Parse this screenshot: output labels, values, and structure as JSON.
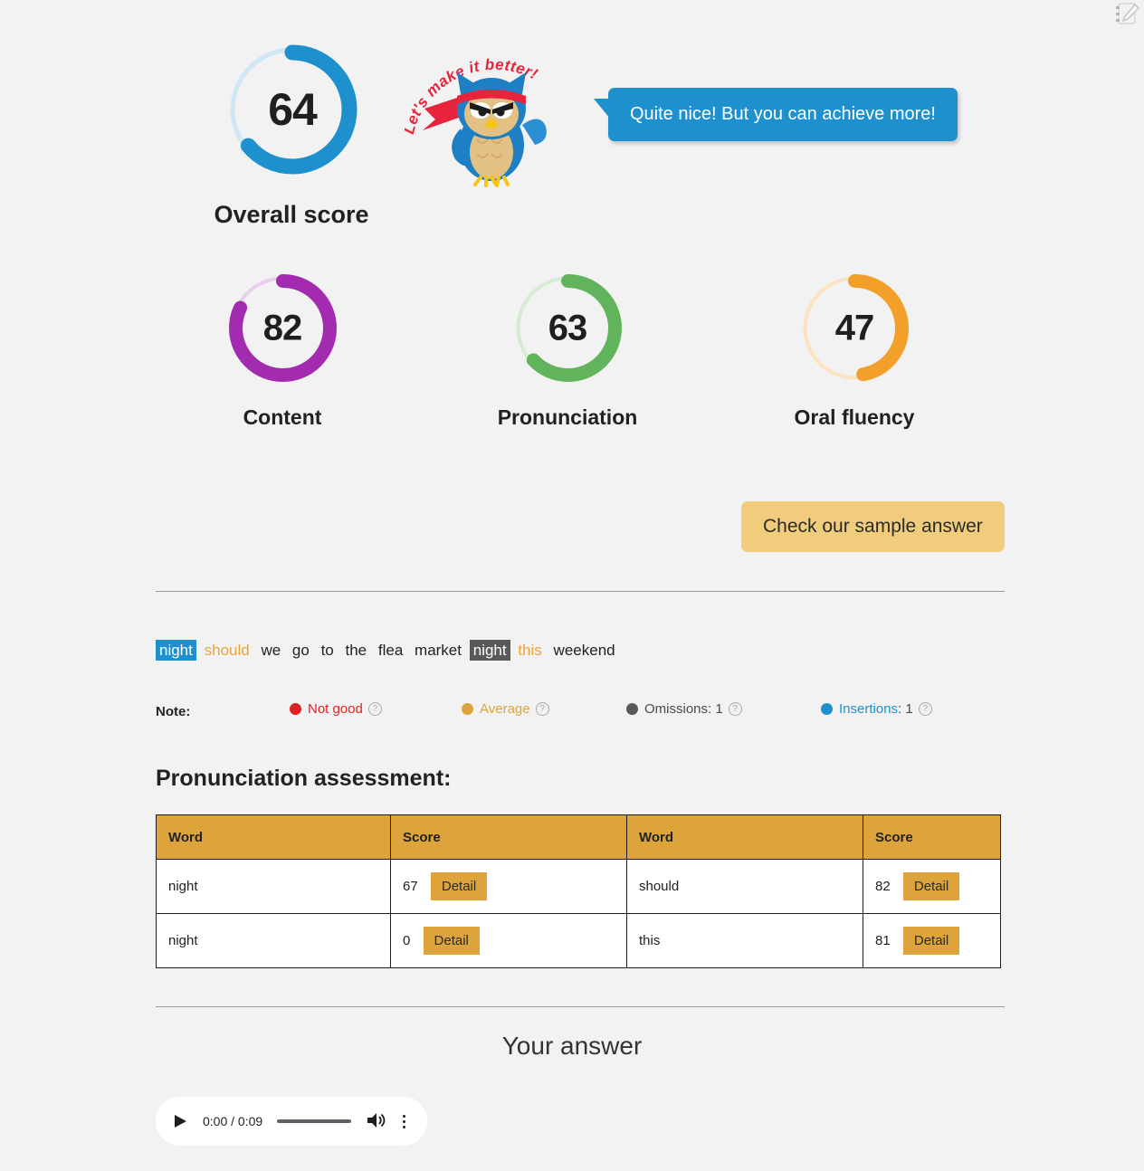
{
  "corner": {
    "icon": "notes-edit-icon"
  },
  "overall": {
    "value": "64",
    "label": "Overall score",
    "color": "#1f90ce",
    "track_color": "#cfe6f4"
  },
  "mascot": {
    "icon": "ninja-owl-mascot",
    "banner_text": "Let's make it better!"
  },
  "bubble": {
    "text": "Quite nice! But you can achieve more!",
    "color": "#1f90ce"
  },
  "sub_scores": [
    {
      "value": "82",
      "label": "Content",
      "color": "#a32baf",
      "track_color": "#e8d0ec"
    },
    {
      "value": "63",
      "label": "Pronunciation",
      "color": "#62b45c",
      "track_color": "#d6ead4"
    },
    {
      "value": "47",
      "label": "Oral fluency",
      "color": "#f2a02a",
      "track_color": "#fbe3bf"
    }
  ],
  "sample_button": {
    "label": "Check our sample answer",
    "color": "#f2cc7d"
  },
  "transcript": {
    "tokens": [
      {
        "text": "night",
        "type": "insertion"
      },
      {
        "text": "should",
        "type": "average"
      },
      {
        "text": "we",
        "type": "plain"
      },
      {
        "text": "go",
        "type": "plain"
      },
      {
        "text": "to",
        "type": "plain"
      },
      {
        "text": "the",
        "type": "plain"
      },
      {
        "text": "flea",
        "type": "plain"
      },
      {
        "text": "market",
        "type": "plain"
      },
      {
        "text": "night",
        "type": "omission"
      },
      {
        "text": "this",
        "type": "average"
      },
      {
        "text": "weekend",
        "type": "plain"
      }
    ]
  },
  "note": {
    "label": "Note:",
    "legend": [
      {
        "text": "Not good",
        "count": "",
        "color": "#e02121",
        "help": "?"
      },
      {
        "text": "Average",
        "count": "",
        "color": "#dda43b",
        "help": "?"
      },
      {
        "text": "Omissions",
        "count": "1",
        "color": "#595959",
        "help": "?"
      },
      {
        "text": "Insertions",
        "count": "1",
        "color": "#1f90ce",
        "help": "?"
      }
    ]
  },
  "pronunciation": {
    "title": "Pronunciation assessment:",
    "headers": [
      "Word",
      "Score",
      "Word",
      "Score"
    ],
    "detail_label": "Detail",
    "rows": [
      {
        "word1": "night",
        "score1": "67",
        "word2": "should",
        "score2": "82"
      },
      {
        "word1": "night",
        "score1": "0",
        "word2": "this",
        "score2": "81"
      }
    ]
  },
  "answer_section": {
    "title": "Your answer",
    "player": {
      "current_time": "0:00",
      "duration": "0:09",
      "time_display": "0:00 / 0:09",
      "play_icon": "play-icon",
      "volume_icon": "volume-icon",
      "menu_icon": "more-vertical-icon"
    }
  },
  "chart_data": {
    "type": "pie",
    "title": "PTE speaking score breakdown",
    "categories": [
      "Overall score",
      "Content",
      "Pronunciation",
      "Oral fluency"
    ],
    "values": [
      64,
      82,
      63,
      47
    ],
    "ylim": [
      0,
      90
    ],
    "colors": [
      "#1f90ce",
      "#a32baf",
      "#62b45c",
      "#f2a02a"
    ],
    "legend": "none",
    "grid": false
  }
}
